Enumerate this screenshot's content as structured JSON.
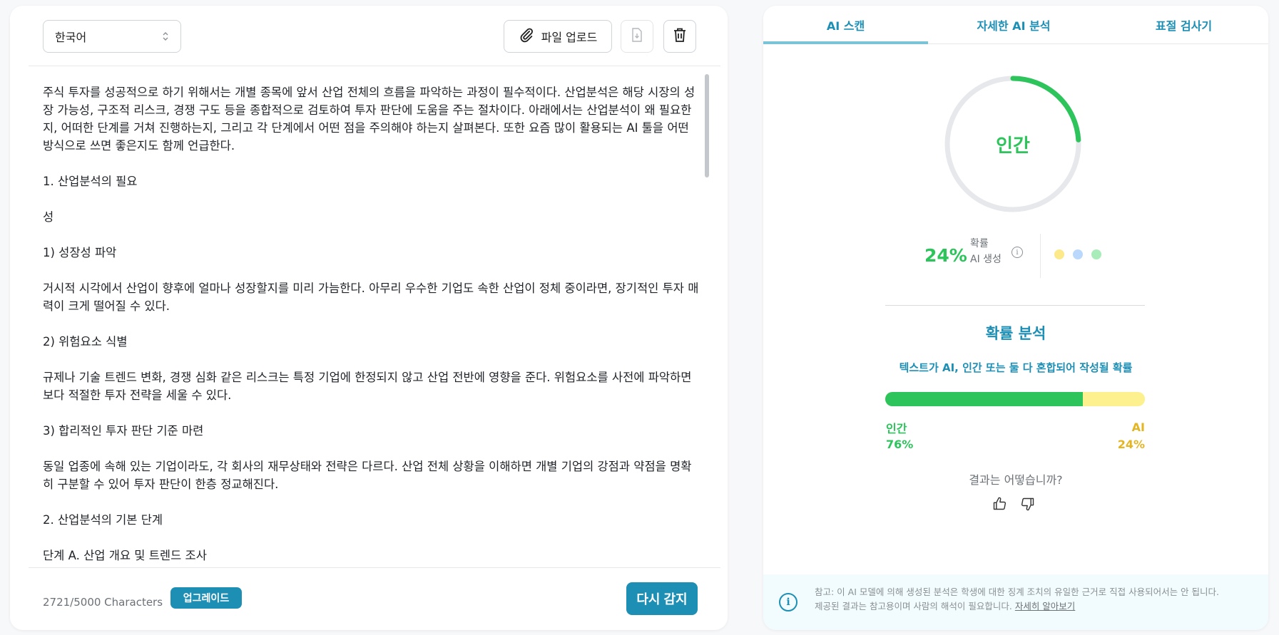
{
  "editor": {
    "language": "한국어",
    "upload_label": "파일 업로드",
    "paragraphs": [
      "주식 투자를 성공적으로 하기 위해서는 개별 종목에 앞서 산업 전체의 흐름을 파악하는 과정이 필수적이다. 산업분석은 해당 시장의 성장 가능성, 구조적 리스크, 경쟁 구도 등을 종합적으로 검토하여 투자 판단에 도움을 주는 절차이다. 아래에서는 산업분석이 왜 필요한지, 어떠한 단계를 거쳐 진행하는지, 그리고 각 단계에서 어떤 점을 주의해야 하는지 살펴본다. 또한 요즘 많이 활용되는 AI 툴을 어떤 방식으로 쓰면 좋은지도 함께 언급한다.",
      "1. 산업분석의 필요",
      "성",
      "1) 성장성 파악",
      "거시적 시각에서 산업이 향후에 얼마나 성장할지를 미리 가늠한다. 아무리 우수한 기업도 속한 산업이 정체 중이라면, 장기적인 투자 매력이 크게 떨어질 수 있다.",
      "2) 위험요소 식별",
      "규제나 기술 트렌드 변화, 경쟁 심화 같은 리스크는 특정 기업에 한정되지 않고 산업 전반에 영향을 준다. 위험요소를 사전에 파악하면 보다 적절한 투자 전략을 세울 수 있다.",
      "3) 합리적인 투자 판단 기준 마련",
      "동일 업종에 속해 있는 기업이라도, 각 회사의 재무상태와 전략은 다르다. 산업 전체 상황을 이해하면 개별 기업의 강점과 약점을 명확히 구분할 수 있어 투자 판단이 한층 정교해진다.",
      "2. 산업분석의 기본 단계",
      "단계 A. 산업 개요 및 트렌드 조사"
    ],
    "char_count": "2721/5000 Characters",
    "upgrade_label": "업그레이드",
    "redetect_label": "다시 감지"
  },
  "tabs": [
    "AI 스캔",
    "자세한 AI 분석",
    "표절 검사기"
  ],
  "result": {
    "verdict": "인간",
    "ai_percent_text": "24%",
    "ai_fraction": 0.24,
    "prob_label_line1": "확률",
    "prob_label_line2": "AI 생성",
    "info_glyph": "i"
  },
  "analysis": {
    "title": "확률 분석",
    "subtitle": "텍스트가 AI, 인간 또는 둘 다 혼합되어 작성될 확률",
    "human_label": "인간",
    "human_percent": "76%",
    "human_value": 76,
    "ai_label": "AI",
    "ai_percent": "24%",
    "ai_value": 24
  },
  "feedback": {
    "question": "결과는 어떻습니까?"
  },
  "notice": {
    "icon_glyph": "i",
    "line1": "참고: 이 AI 모델에 의해 생성된 분석은 학생에 대한 징계 조치의 유일한 근거로 직접 사용되어서는 안 됩니다.",
    "line2": "제공된 결과는 참고용이며 사람의 해석이 필요합니다.",
    "link": "자세히 알아보기"
  },
  "colors": {
    "accent": "#1d8fb5",
    "human_green": "#2cc45b",
    "ai_yellow": "#fdf08f",
    "ai_text": "#e3b520",
    "gauge_track": "#e6e8eb"
  },
  "icons": {
    "language_chevron": "chevron-updown-icon",
    "upload": "paperclip-icon",
    "download": "download-file-icon",
    "delete": "trash-icon",
    "info": "info-icon",
    "thumbs_up": "thumbs-up-icon",
    "thumbs_down": "thumbs-down-icon"
  }
}
